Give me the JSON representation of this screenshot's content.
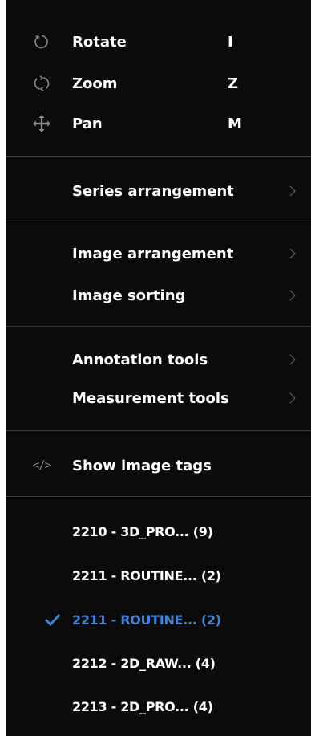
{
  "tools": [
    {
      "label": "Rotate",
      "shortcut": "I",
      "icon": "rotate-icon"
    },
    {
      "label": "Zoom",
      "shortcut": "Z",
      "icon": "zoom-icon"
    },
    {
      "label": "Pan",
      "shortcut": "M",
      "icon": "pan-icon"
    }
  ],
  "arrangement": {
    "series_label": "Series arrangement",
    "image_arrangement_label": "Image arrangement",
    "image_sorting_label": "Image sorting"
  },
  "tool_menus": {
    "annotation_label": "Annotation tools",
    "measurement_label": "Measurement tools"
  },
  "tags": {
    "label": "Show image tags",
    "icon_text": "</>"
  },
  "series": [
    {
      "label": "2210 - 3D_PRO... (9)",
      "selected": false
    },
    {
      "label": "2211 - ROUTINE... (2)",
      "selected": false
    },
    {
      "label": "2211 - ROUTINE... (2)",
      "selected": true
    },
    {
      "label": "2212 - 2D_RAW... (4)",
      "selected": false
    },
    {
      "label": "2213 - 2D_PRO... (4)",
      "selected": false
    }
  ],
  "colors": {
    "background": "#0b0b0b",
    "text": "#ffffff",
    "selected": "#3f83d8",
    "divider": "#3a3a3a"
  }
}
